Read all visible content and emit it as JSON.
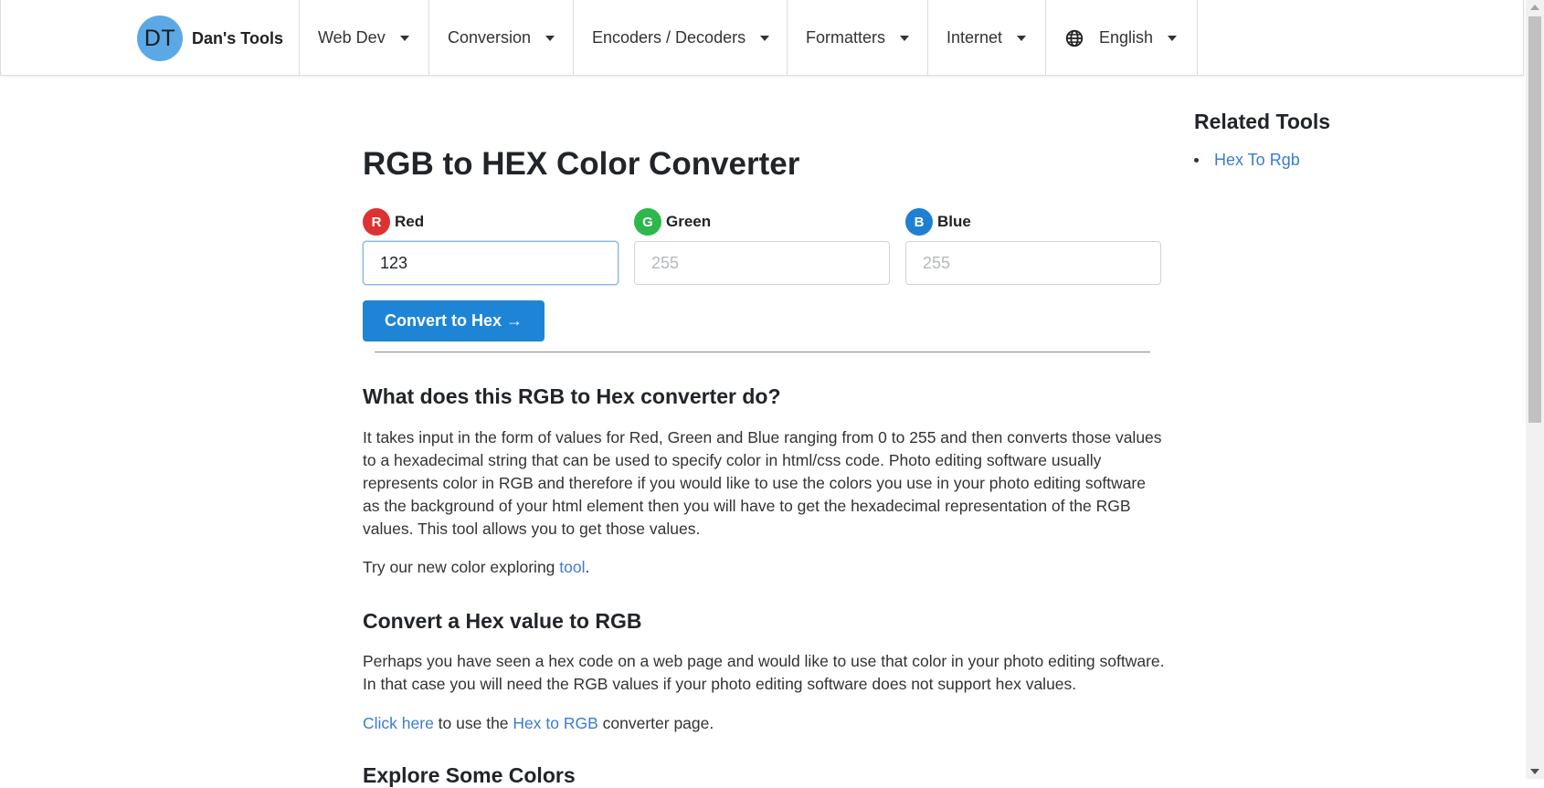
{
  "brand": {
    "logo_text": "DT",
    "name": "Dan's Tools"
  },
  "nav": {
    "items": [
      {
        "label": "Web Dev"
      },
      {
        "label": "Conversion"
      },
      {
        "label": "Encoders / Decoders"
      },
      {
        "label": "Formatters"
      },
      {
        "label": "Internet"
      }
    ],
    "language": {
      "label": "English",
      "icon": "globe-icon"
    }
  },
  "main": {
    "title": "RGB to HEX Color Converter",
    "fields": {
      "red": {
        "badge": "R",
        "label": "Red",
        "value": "123",
        "placeholder": "255",
        "color": "#dc3232"
      },
      "green": {
        "badge": "G",
        "label": "Green",
        "value": "",
        "placeholder": "255",
        "color": "#2db84b"
      },
      "blue": {
        "badge": "B",
        "label": "Blue",
        "value": "",
        "placeholder": "255",
        "color": "#1e7fd3"
      }
    },
    "convert_button": "Convert to Hex →",
    "section1": {
      "heading": "What does this RGB to Hex converter do?",
      "paragraph": "It takes input in the form of values for Red, Green and Blue ranging from 0 to 255 and then converts those values to a hexadecimal string that can be used to specify color in html/css code. Photo editing software usually represents color in RGB and therefore if you would like to use the colors you use in your photo editing software as the background of your html element then you will have to get the hexadecimal representation of the RGB values. This tool allows you to get those values.",
      "try_prefix": "Try our new color exploring ",
      "try_link": "tool",
      "try_suffix": "."
    },
    "section2": {
      "heading": "Convert a Hex value to RGB",
      "paragraph": "Perhaps you have seen a hex code on a web page and would like to use that color in your photo editing software. In that case you will need the RGB values if your photo editing software does not support hex values.",
      "click_link": "Click here",
      "middle_text": " to use the ",
      "hex_link": "Hex to RGB",
      "end_text": " converter page."
    },
    "section3": {
      "heading": "Explore Some Colors"
    }
  },
  "sidebar": {
    "title": "Related Tools",
    "links": [
      {
        "label": "Hex To Rgb"
      }
    ]
  },
  "colors": {
    "accent": "#1e84d6",
    "link": "#3a7bd5",
    "logo_bg": "#5aa9e6"
  }
}
